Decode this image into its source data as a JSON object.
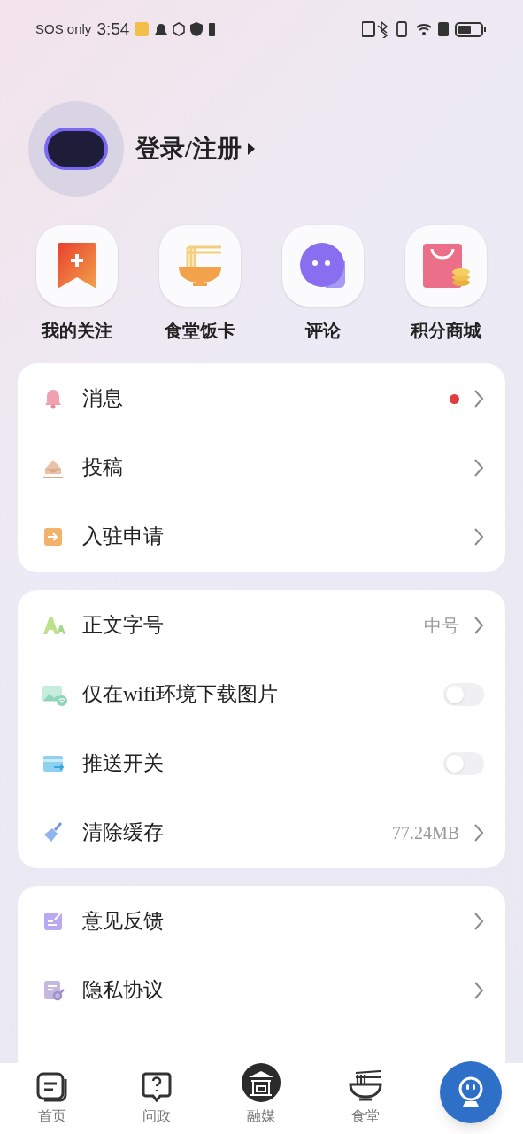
{
  "status_bar": {
    "carrier": "SOS only",
    "time": "3:54"
  },
  "profile": {
    "login": "登录/注册"
  },
  "shortcuts": [
    {
      "label": "我的关注"
    },
    {
      "label": "食堂饭卡"
    },
    {
      "label": "评论"
    },
    {
      "label": "积分商城"
    }
  ],
  "cards": [
    {
      "rows": [
        {
          "kind": "link",
          "label": "消息",
          "dot": true
        },
        {
          "kind": "link",
          "label": "投稿",
          "dot": false
        },
        {
          "kind": "link",
          "label": "入驻申请",
          "dot": false
        }
      ]
    },
    {
      "rows": [
        {
          "kind": "link",
          "label": "正文字号",
          "value": "中号",
          "dot": false
        },
        {
          "kind": "toggle",
          "label": "仅在wifi环境下载图片",
          "on": false
        },
        {
          "kind": "toggle",
          "label": "推送开关",
          "on": false
        },
        {
          "kind": "link",
          "label": "清除缓存",
          "value": "77.24MB",
          "dot": false
        }
      ]
    },
    {
      "rows": [
        {
          "kind": "link",
          "label": "意见反馈",
          "dot": false
        },
        {
          "kind": "link",
          "label": "隐私协议",
          "dot": false
        }
      ]
    }
  ],
  "tab_bar": [
    {
      "label": "首页"
    },
    {
      "label": "问政"
    },
    {
      "label": "融媒"
    },
    {
      "label": "食堂"
    }
  ]
}
